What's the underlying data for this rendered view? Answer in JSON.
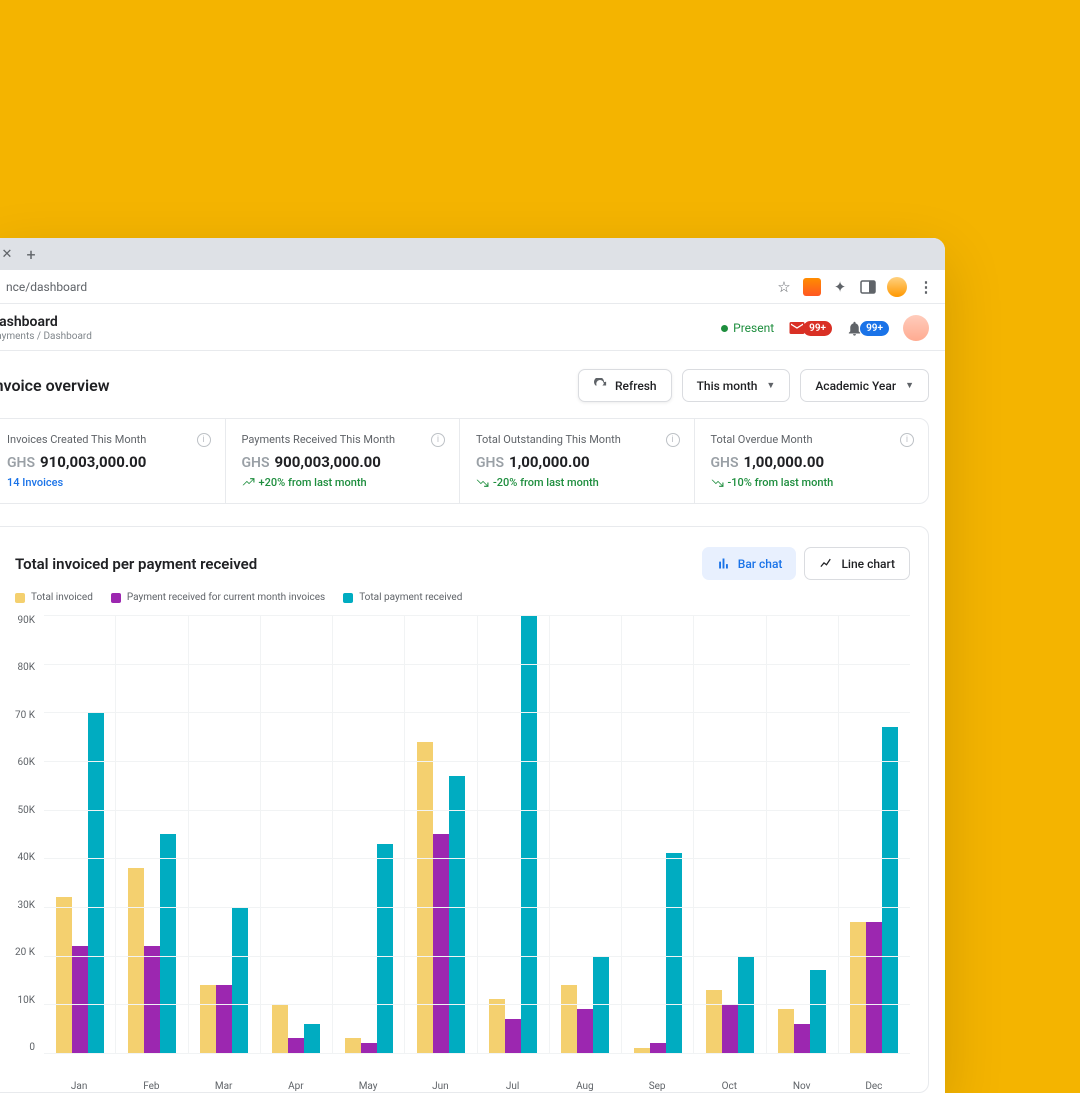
{
  "browser": {
    "url": "nce/dashboard"
  },
  "header": {
    "title": "Dashboard",
    "breadcrumb": "Payments / Dashboard",
    "present": "Present",
    "mail_badge": "99+",
    "bell_badge": "99+"
  },
  "overview": {
    "title": "Invoice overview",
    "refresh": "Refresh",
    "filter1": "This month",
    "filter2": "Academic Year"
  },
  "cards": [
    {
      "title": "Invoices Created This Month",
      "currency": "GHS",
      "amount": "910,003,000.00",
      "sub": "14 Invoices",
      "sub_class": "sub-blue",
      "trend": ""
    },
    {
      "title": "Payments Received This Month",
      "currency": "GHS",
      "amount": "900,003,000.00",
      "sub": "+20% from last month",
      "sub_class": "sub-green",
      "trend": "up"
    },
    {
      "title": "Total Outstanding This Month",
      "currency": "GHS",
      "amount": "1,00,000.00",
      "sub": "-20% from last month",
      "sub_class": "sub-green",
      "trend": "down"
    },
    {
      "title": "Total Overdue Month",
      "currency": "GHS",
      "amount": "1,00,000.00",
      "sub": "-10% from last month",
      "sub_class": "sub-green",
      "trend": "down"
    }
  ],
  "chart": {
    "title": "Total invoiced per payment received",
    "toggle_bar": "Bar chat",
    "toggle_line": "Line chart",
    "legend": [
      "Total invoiced",
      "Payment received for current month invoices",
      "Total payment received"
    ]
  },
  "chart_data": {
    "type": "bar",
    "title": "Total invoiced per payment received",
    "xlabel": "",
    "ylabel": "",
    "ylim": [
      0,
      90
    ],
    "y_ticks": [
      "90K",
      "80K",
      "70 K",
      "60K",
      "50K",
      "40K",
      "30K",
      "20 K",
      "10K",
      "0"
    ],
    "categories": [
      "Jan",
      "Feb",
      "Mar",
      "Apr",
      "May",
      "Jun",
      "Jul",
      "Aug",
      "Sep",
      "Oct",
      "Nov",
      "Dec"
    ],
    "series": [
      {
        "name": "Total invoiced",
        "color": "#f4d06f",
        "values": [
          32,
          38,
          14,
          10,
          3,
          64,
          11,
          14,
          1,
          13,
          9,
          27
        ]
      },
      {
        "name": "Payment received for current month invoices",
        "color": "#9c27b0",
        "values": [
          22,
          22,
          14,
          3,
          2,
          45,
          7,
          9,
          2,
          10,
          6,
          27
        ]
      },
      {
        "name": "Total payment received",
        "color": "#00acc1",
        "values": [
          70,
          45,
          30,
          6,
          43,
          57,
          90,
          20,
          41,
          20,
          17,
          67
        ]
      }
    ]
  }
}
